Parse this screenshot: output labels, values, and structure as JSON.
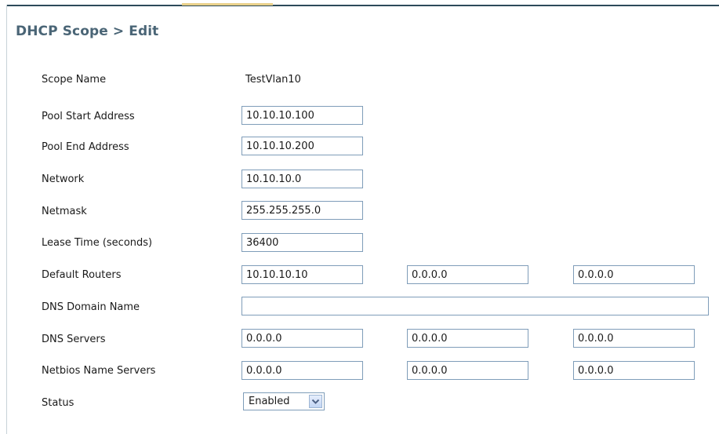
{
  "page": {
    "title": "DHCP Scope > Edit"
  },
  "form": {
    "scope_name": {
      "label": "Scope Name",
      "value": "TestVlan10"
    },
    "pool_start": {
      "label": "Pool Start Address",
      "value": "10.10.10.100"
    },
    "pool_end": {
      "label": "Pool End Address",
      "value": "10.10.10.200"
    },
    "network": {
      "label": "Network",
      "value": "10.10.10.0"
    },
    "netmask": {
      "label": "Netmask",
      "value": "255.255.255.0"
    },
    "lease_time": {
      "label": "Lease Time (seconds)",
      "value": "36400"
    },
    "default_routers": {
      "label": "Default Routers",
      "values": [
        "10.10.10.10",
        "0.0.0.0",
        "0.0.0.0"
      ]
    },
    "dns_domain_name": {
      "label": "DNS Domain Name",
      "value": ""
    },
    "dns_servers": {
      "label": "DNS Servers",
      "values": [
        "0.0.0.0",
        "0.0.0.0",
        "0.0.0.0"
      ]
    },
    "netbios_servers": {
      "label": "Netbios Name Servers",
      "values": [
        "0.0.0.0",
        "0.0.0.0",
        "0.0.0.0"
      ]
    },
    "status": {
      "label": "Status",
      "selected": "Enabled",
      "icon": "chevron-down-icon"
    }
  },
  "colors": {
    "title": "#4a6576",
    "input_border": "#7f9db9",
    "frame_top": "#2d4a5a",
    "frame_accent": "#e9d08a",
    "arrow_button": "#c2d5f4",
    "arrow_glyph": "#4d6185"
  }
}
